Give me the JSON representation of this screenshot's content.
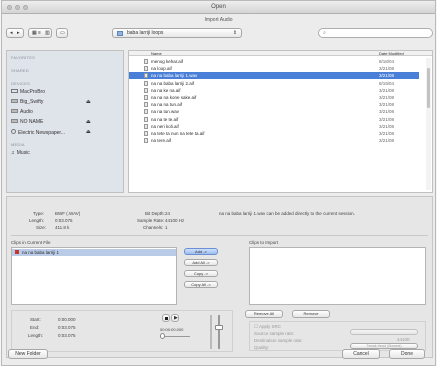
{
  "window": {
    "title": "Open",
    "subtitle": "Import Audio"
  },
  "toolbar": {
    "folder": "baba larriji loops",
    "search_placeholder": ""
  },
  "sidebar": {
    "favorites": "FAVORITES",
    "shared": "SHARED",
    "devices": "DEVICES",
    "device_items": [
      "MacProBro",
      "Big_Swifty",
      "Audio",
      "NO NAME",
      "Electric Newspaper..."
    ],
    "media": "MEDIA",
    "media_items": [
      "Music"
    ]
  },
  "filelist": {
    "col_name": "Name",
    "col_date": "Date Modified",
    "rows": [
      {
        "name": "menog kehar.aif",
        "date": "8/18/04"
      },
      {
        "name": "na loop.aif",
        "date": "3/21/08"
      },
      {
        "name": "na na baba larriji 1.wav",
        "date": "3/21/08"
      },
      {
        "name": "na na baba larriji 2.aif",
        "date": "8/19/04"
      },
      {
        "name": "na na ke na.aif",
        "date": "3/21/08"
      },
      {
        "name": "na na na kone sake.aif",
        "date": "3/21/08"
      },
      {
        "name": "na na na tun.aif",
        "date": "3/21/08"
      },
      {
        "name": "na na tun.wav",
        "date": "3/21/08"
      },
      {
        "name": "na na te te.aif",
        "date": "3/21/08"
      },
      {
        "name": "na neri koli.aif",
        "date": "3/21/08"
      },
      {
        "name": "na tete ta nun na tete ta.aif",
        "date": "3/21/08"
      },
      {
        "name": "na tere.aif",
        "date": "3/21/08"
      }
    ],
    "selected_index": 2
  },
  "details": {
    "type_label": "Type:",
    "type_value": "BWF (.WAV)",
    "length_label": "Length:",
    "length_value": "0:03.075",
    "size_label": "Size:",
    "size_value": "411.8 k",
    "bitdepth_label": "Bit Depth:",
    "bitdepth_value": "24",
    "rate_label": "Sample Rate:",
    "rate_value": "44100 Hz",
    "channels_label": "Channels:",
    "channels_value": "1",
    "message": "na na baba larriji 1.wav can be added directly to the current session."
  },
  "clips": {
    "current_label": "Clips in Current File",
    "current_items": [
      "na na baba larriji 1"
    ],
    "import_label": "Clips to Import",
    "add": "Add ->",
    "add_all": "Add All ->",
    "copy": "Copy ->",
    "copy_all": "Copy All ->",
    "remove_all": "Remove All",
    "remove": "Remove"
  },
  "playback": {
    "start_label": "Start:",
    "start_value": "0:00.000",
    "end_label": "End:",
    "end_value": "0:03.075",
    "length_label": "Length:",
    "length_value": "0:03.075",
    "time": "00:00:00.000"
  },
  "convert": {
    "apply_src": "Apply SRC",
    "source_rate": "Source sample rate:",
    "dest_rate": "Destination sample rate:",
    "dest_value": "44100",
    "quality": "Quality:",
    "quality_value": "Tweak Head (Slowest)"
  },
  "buttons": {
    "new_folder": "New Folder",
    "cancel": "Cancel",
    "done": "Done"
  }
}
